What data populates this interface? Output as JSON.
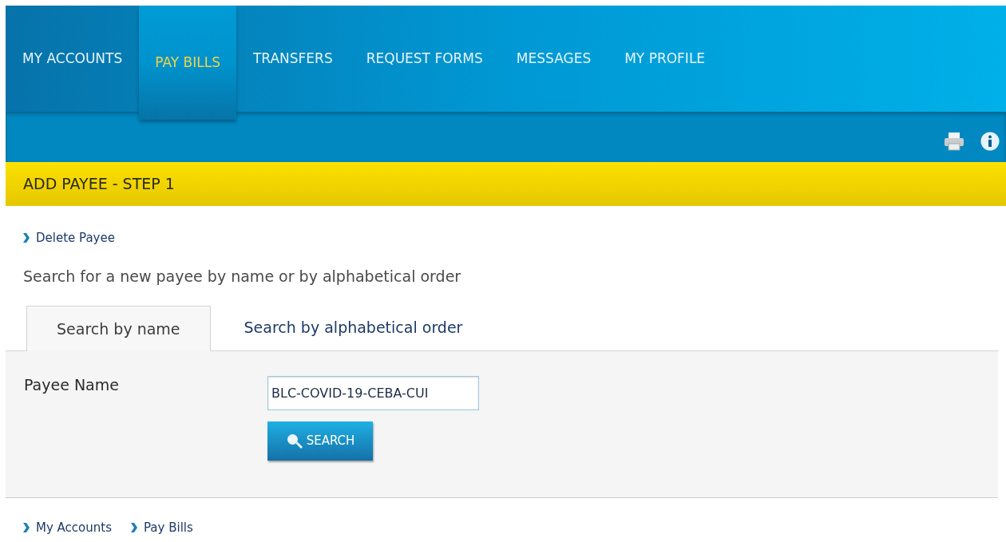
{
  "nav": [
    {
      "label": "MY ACCOUNTS",
      "selected": false
    },
    {
      "label": "PAY BILLS",
      "selected": true
    },
    {
      "label": "TRANSFERS",
      "selected": false
    },
    {
      "label": "REQUEST FORMS",
      "selected": false
    },
    {
      "label": "MESSAGES",
      "selected": false
    },
    {
      "label": "MY PROFILE",
      "selected": false
    }
  ],
  "section_title": "ADD PAYEE - STEP 1",
  "top_links": [
    "Delete Payee"
  ],
  "intro": "Search for a new payee by name or by alphabetical order",
  "tabs": [
    {
      "label": "Search by name",
      "selected": true
    },
    {
      "label": "Search by alphabetical order",
      "selected": false
    }
  ],
  "form": {
    "label": "Payee Name",
    "value": "BLC-COVID-19-CEBA-CUI",
    "button": "SEARCH"
  },
  "bottom_links": [
    "My Accounts",
    "Pay Bills"
  ]
}
